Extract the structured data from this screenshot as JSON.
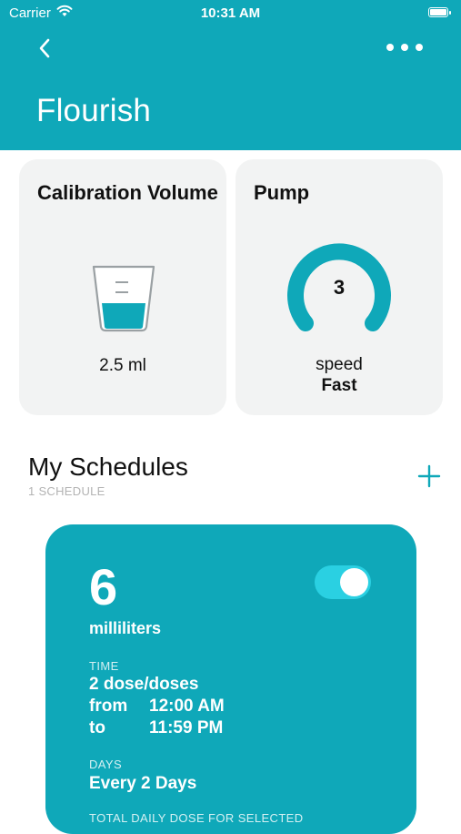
{
  "status_bar": {
    "carrier": "Carrier",
    "time": "10:31 AM"
  },
  "header": {
    "title": "Flourish"
  },
  "calibration": {
    "title": "Calibration Volume",
    "value": "2.5 ml"
  },
  "pump": {
    "title": "Pump",
    "speed_number": "3",
    "speed_label": "speed",
    "speed_value": "Fast"
  },
  "schedules": {
    "title": "My Schedules",
    "count": "1 SCHEDULE"
  },
  "schedule_card": {
    "amount": "6",
    "unit": "milliliters",
    "time_label": "TIME",
    "doses": "2 dose/doses",
    "from_label": "from",
    "from_value": "12:00 AM",
    "to_label": "to",
    "to_value": "11:59 PM",
    "days_label": "DAYS",
    "days_value": "Every 2 Days",
    "total_label": "TOTAL DAILY DOSE FOR SELECTED",
    "enabled": true
  },
  "colors": {
    "brand": "#0fa8b9",
    "card_bg": "#f2f3f3",
    "toggle_track": "#2ad0e2"
  }
}
